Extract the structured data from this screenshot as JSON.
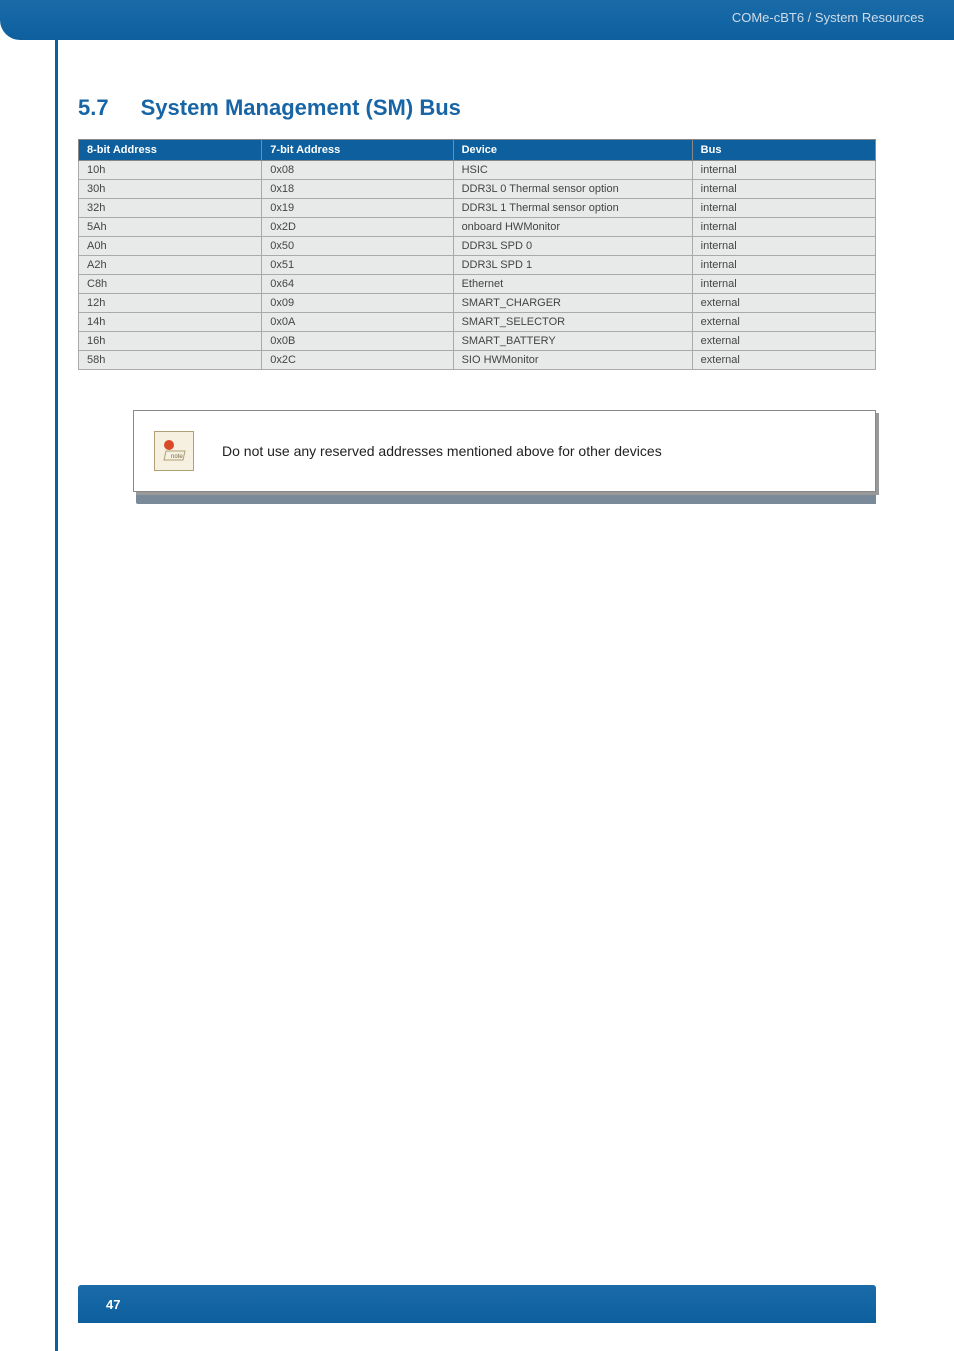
{
  "header": {
    "breadcrumb": "COMe-cBT6 / System Resources"
  },
  "section": {
    "number": "5.7",
    "title": "System Management (SM) Bus"
  },
  "table": {
    "headers": {
      "addr8": "8-bit Address",
      "addr7": "7-bit Address",
      "device": "Device",
      "bus": "Bus"
    },
    "rows": [
      {
        "addr8": "10h",
        "addr7": "0x08",
        "device": "HSIC",
        "bus": "internal"
      },
      {
        "addr8": "30h",
        "addr7": "0x18",
        "device": "DDR3L 0 Thermal sensor option",
        "bus": "internal"
      },
      {
        "addr8": "32h",
        "addr7": "0x19",
        "device": "DDR3L 1 Thermal sensor option",
        "bus": "internal"
      },
      {
        "addr8": "5Ah",
        "addr7": "0x2D",
        "device": "onboard HWMonitor",
        "bus": "internal"
      },
      {
        "addr8": "A0h",
        "addr7": "0x50",
        "device": "DDR3L SPD 0",
        "bus": "internal"
      },
      {
        "addr8": "A2h",
        "addr7": "0x51",
        "device": "DDR3L SPD 1",
        "bus": "internal"
      },
      {
        "addr8": "C8h",
        "addr7": "0x64",
        "device": "Ethernet",
        "bus": "internal"
      },
      {
        "addr8": "12h",
        "addr7": "0x09",
        "device": "SMART_CHARGER",
        "bus": "external"
      },
      {
        "addr8": "14h",
        "addr7": "0x0A",
        "device": "SMART_SELECTOR",
        "bus": "external"
      },
      {
        "addr8": "16h",
        "addr7": "0x0B",
        "device": "SMART_BATTERY",
        "bus": "external"
      },
      {
        "addr8": "58h",
        "addr7": "0x2C",
        "device": "SIO HWMonitor",
        "bus": "external"
      }
    ]
  },
  "note": {
    "icon_label": "note",
    "text": "Do not use any reserved addresses mentioned above for other devices"
  },
  "footer": {
    "page": "47"
  }
}
